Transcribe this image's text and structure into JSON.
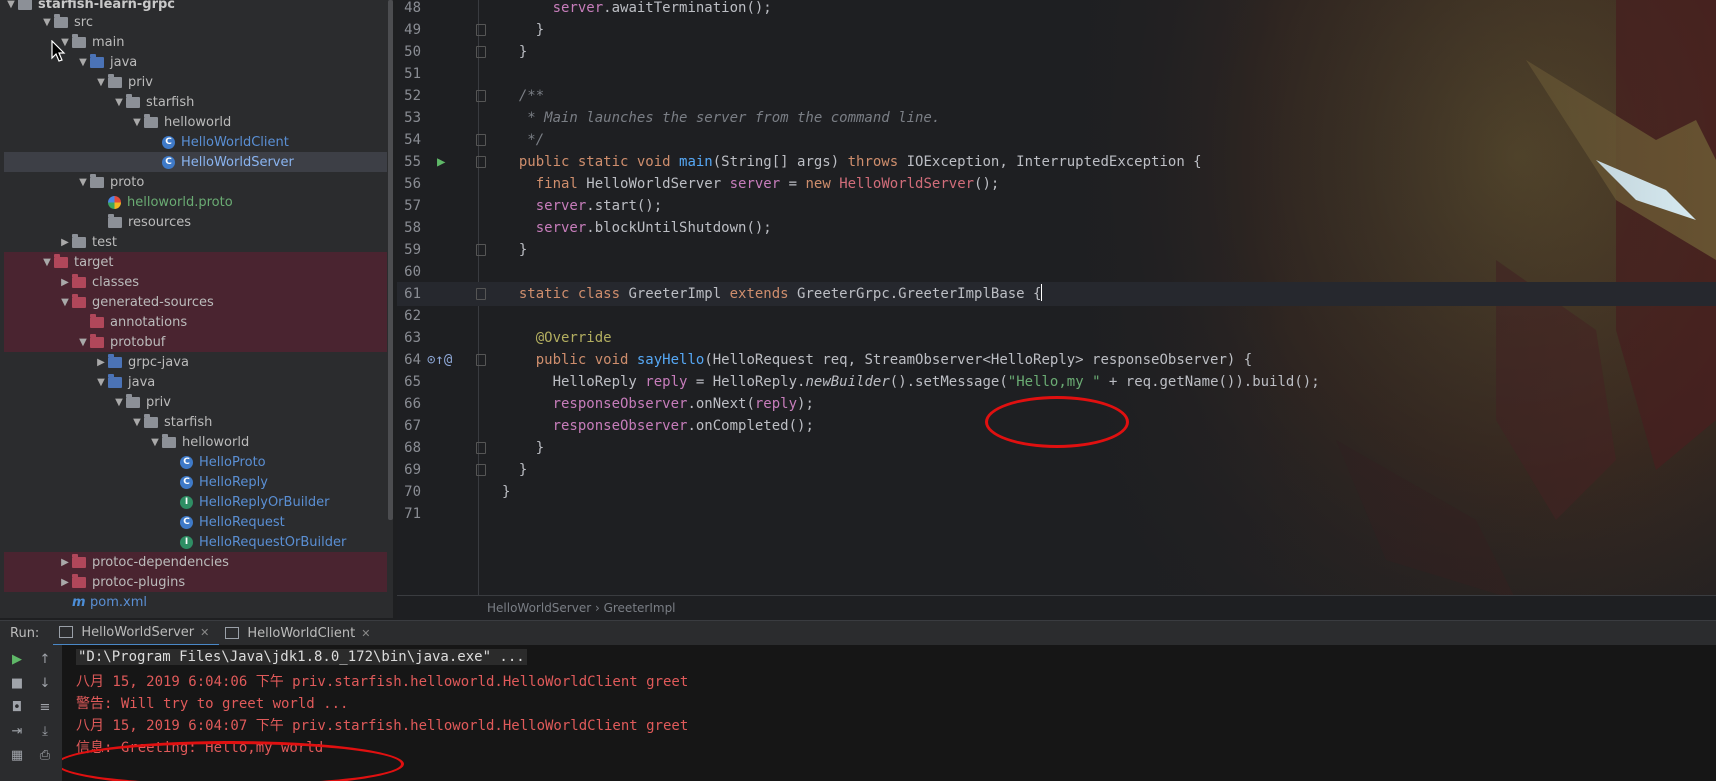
{
  "project_tree": {
    "root_label": "starfish-learn-grpc",
    "items": [
      {
        "label": "src",
        "depth": 1,
        "arrow": "▼",
        "icon": "folder",
        "style": "normal"
      },
      {
        "label": "main",
        "depth": 2,
        "arrow": "▼",
        "icon": "folder",
        "style": "normal"
      },
      {
        "label": "java",
        "depth": 3,
        "arrow": "▼",
        "icon": "folder-blue",
        "style": "normal"
      },
      {
        "label": "priv",
        "depth": 4,
        "arrow": "▼",
        "icon": "package",
        "style": "normal"
      },
      {
        "label": "starfish",
        "depth": 5,
        "arrow": "▼",
        "icon": "package",
        "style": "normal"
      },
      {
        "label": "helloworld",
        "depth": 6,
        "arrow": "▼",
        "icon": "package",
        "style": "normal"
      },
      {
        "label": "HelloWorldClient",
        "depth": 7,
        "arrow": "",
        "icon": "class",
        "style": "blue"
      },
      {
        "label": "HelloWorldServer",
        "depth": 7,
        "arrow": "",
        "icon": "class",
        "style": "selected"
      },
      {
        "label": "proto",
        "depth": 3,
        "arrow": "▼",
        "icon": "folder",
        "style": "normal"
      },
      {
        "label": "helloworld.proto",
        "depth": 4,
        "arrow": "",
        "icon": "proto-file",
        "style": "green"
      },
      {
        "label": "resources",
        "depth": 4,
        "arrow": "",
        "icon": "folder",
        "style": "normal"
      },
      {
        "label": "test",
        "depth": 2,
        "arrow": "▶",
        "icon": "folder",
        "style": "normal"
      },
      {
        "label": "target",
        "depth": 1,
        "arrow": "▼",
        "icon": "folder-red",
        "style": "excluded"
      },
      {
        "label": "classes",
        "depth": 2,
        "arrow": "▶",
        "icon": "folder-red",
        "style": "excluded"
      },
      {
        "label": "generated-sources",
        "depth": 2,
        "arrow": "▼",
        "icon": "folder-red",
        "style": "excluded"
      },
      {
        "label": "annotations",
        "depth": 3,
        "arrow": "",
        "icon": "folder-red",
        "style": "excluded"
      },
      {
        "label": "protobuf",
        "depth": 3,
        "arrow": "▼",
        "icon": "folder-red",
        "style": "excluded"
      },
      {
        "label": "grpc-java",
        "depth": 4,
        "arrow": "▶",
        "icon": "folder-blue",
        "style": "normal"
      },
      {
        "label": "java",
        "depth": 4,
        "arrow": "▼",
        "icon": "folder-blue",
        "style": "normal"
      },
      {
        "label": "priv",
        "depth": 5,
        "arrow": "▼",
        "icon": "package",
        "style": "normal"
      },
      {
        "label": "starfish",
        "depth": 6,
        "arrow": "▼",
        "icon": "package",
        "style": "normal"
      },
      {
        "label": "helloworld",
        "depth": 7,
        "arrow": "▼",
        "icon": "package",
        "style": "normal"
      },
      {
        "label": "HelloProto",
        "depth": 8,
        "arrow": "",
        "icon": "class",
        "style": "blue"
      },
      {
        "label": "HelloReply",
        "depth": 8,
        "arrow": "",
        "icon": "class",
        "style": "blue"
      },
      {
        "label": "HelloReplyOrBuilder",
        "depth": 8,
        "arrow": "",
        "icon": "interface",
        "style": "blue"
      },
      {
        "label": "HelloRequest",
        "depth": 8,
        "arrow": "",
        "icon": "class",
        "style": "blue"
      },
      {
        "label": "HelloRequestOrBuilder",
        "depth": 8,
        "arrow": "",
        "icon": "interface",
        "style": "blue"
      },
      {
        "label": "protoc-dependencies",
        "depth": 2,
        "arrow": "▶",
        "icon": "folder-red",
        "style": "excluded"
      },
      {
        "label": "protoc-plugins",
        "depth": 2,
        "arrow": "▶",
        "icon": "folder-red",
        "style": "excluded"
      },
      {
        "label": "pom.xml",
        "depth": 2,
        "arrow": "",
        "icon": "maven",
        "style": "blue"
      }
    ]
  },
  "editor": {
    "line_numbers": [
      "48",
      "49",
      "50",
      "51",
      "52",
      "53",
      "54",
      "55",
      "56",
      "57",
      "58",
      "59",
      "60",
      "61",
      "62",
      "63",
      "64",
      "65",
      "66",
      "67",
      "68",
      "69",
      "70",
      "71"
    ],
    "lines": [
      [
        {
          "t": "      "
        },
        {
          "t": "server",
          "c": "fld"
        },
        {
          "t": ".awaitTermination();"
        }
      ],
      [
        {
          "t": "    }"
        }
      ],
      [
        {
          "t": "  }"
        }
      ],
      [
        {
          "t": ""
        }
      ],
      [
        {
          "t": "  /**",
          "c": "cmt"
        }
      ],
      [
        {
          "t": "   * Main launches the server from the command line.",
          "c": "cmt"
        }
      ],
      [
        {
          "t": "   */",
          "c": "cmt"
        }
      ],
      [
        {
          "t": "  "
        },
        {
          "t": "public static void ",
          "c": "kw"
        },
        {
          "t": "main",
          "c": "fn"
        },
        {
          "t": "(String[] args) "
        },
        {
          "t": "throws ",
          "c": "kw"
        },
        {
          "t": "IOException, InterruptedException {"
        }
      ],
      [
        {
          "t": "    "
        },
        {
          "t": "final ",
          "c": "kw"
        },
        {
          "t": "HelloWorldServer "
        },
        {
          "t": "server",
          "c": "fld"
        },
        {
          "t": " = "
        },
        {
          "t": "new ",
          "c": "kw"
        },
        {
          "t": "HelloWorldServer",
          "c": "cls-red"
        },
        {
          "t": "();"
        }
      ],
      [
        {
          "t": "    "
        },
        {
          "t": "server",
          "c": "fld"
        },
        {
          "t": ".start();"
        }
      ],
      [
        {
          "t": "    "
        },
        {
          "t": "server",
          "c": "fld"
        },
        {
          "t": ".blockUntilShutdown();"
        }
      ],
      [
        {
          "t": "  }"
        }
      ],
      [
        {
          "t": ""
        }
      ],
      [
        {
          "t": "  "
        },
        {
          "t": "static class ",
          "c": "kw"
        },
        {
          "t": "GreeterImpl "
        },
        {
          "t": "extends ",
          "c": "kw"
        },
        {
          "t": "GreeterGrpc.GreeterImplBase {"
        }
      ],
      [
        {
          "t": ""
        }
      ],
      [
        {
          "t": "    "
        },
        {
          "t": "@Override",
          "c": "ann"
        }
      ],
      [
        {
          "t": "    "
        },
        {
          "t": "public void ",
          "c": "kw"
        },
        {
          "t": "sayHello",
          "c": "fn"
        },
        {
          "t": "(HelloRequest req, StreamObserver<HelloReply> responseObserver) {"
        }
      ],
      [
        {
          "t": "      HelloReply "
        },
        {
          "t": "reply",
          "c": "fld"
        },
        {
          "t": " = HelloReply."
        },
        {
          "t": "newBuilder",
          "c": "ital"
        },
        {
          "t": "().setMessage("
        },
        {
          "t": "\"Hello,my \"",
          "c": "str"
        },
        {
          "t": " + req.getName()).build();"
        }
      ],
      [
        {
          "t": "      "
        },
        {
          "t": "responseObserver",
          "c": "fld"
        },
        {
          "t": ".onNext("
        },
        {
          "t": "reply",
          "c": "fld"
        },
        {
          "t": ");"
        }
      ],
      [
        {
          "t": "      "
        },
        {
          "t": "responseObserver",
          "c": "fld"
        },
        {
          "t": ".onCompleted();"
        }
      ],
      [
        {
          "t": "    }"
        }
      ],
      [
        {
          "t": "  }"
        }
      ],
      [
        {
          "t": "}"
        }
      ],
      [
        {
          "t": ""
        }
      ]
    ],
    "breadcrumb": "HelloWorldServer  ›  GreeterImpl"
  },
  "run_panel": {
    "label": "Run:",
    "tabs": [
      {
        "label": "HelloWorldServer",
        "close": "✕"
      },
      {
        "label": "HelloWorldClient",
        "close": "✕"
      }
    ],
    "output": [
      {
        "text": "\"D:\\Program Files\\Java\\jdk1.8.0_172\\bin\\java.exe\" ...",
        "style": "cmd"
      },
      {
        "text": "八月 15, 2019 6:04:06 下午 priv.starfish.helloworld.HelloWorldClient greet",
        "style": "err"
      },
      {
        "text": "警告: Will try to greet world ...",
        "style": "err"
      },
      {
        "text": "八月 15, 2019 6:04:07 下午 priv.starfish.helloworld.HelloWorldClient greet",
        "style": "err"
      },
      {
        "text": "信息: Greeting: Hello,my world",
        "style": "err"
      }
    ]
  },
  "colors": {
    "keyword": "#cf8e6d",
    "string": "#6aab73",
    "field": "#c77dbb",
    "annotation": "#b3ae60",
    "error_output": "#e05a5a",
    "highlight_ellipse": "#e01010"
  }
}
